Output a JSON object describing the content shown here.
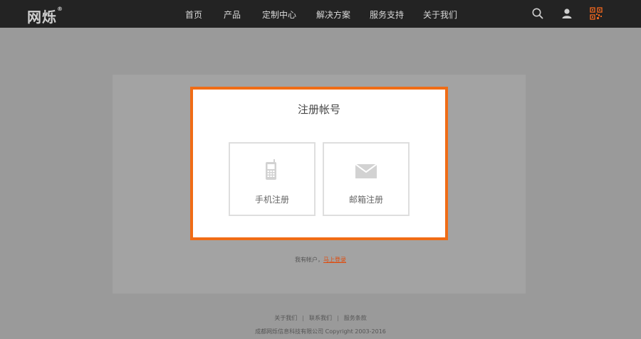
{
  "header": {
    "logo_text": "网烁",
    "logo_mark": "®",
    "nav": [
      "首页",
      "产品",
      "定制中心",
      "解决方案",
      "服务支持",
      "关于我们"
    ],
    "icons": [
      "search-icon",
      "user-icon",
      "qr-code-icon"
    ]
  },
  "register": {
    "title": "注册帐号",
    "phone_label": "手机注册",
    "email_label": "邮箱注册"
  },
  "login": {
    "prompt": "我有帐户，",
    "link": "马上登录"
  },
  "footer": {
    "links": [
      "关于我们",
      "联系我们",
      "服务条款"
    ],
    "separator": "|",
    "copyright": "成都网烁信息科技有限公司 Copyright 2003-2016"
  },
  "colors": {
    "accent": "#f06c16",
    "topbar": "#232323",
    "overlay": "#9a9a9a"
  }
}
